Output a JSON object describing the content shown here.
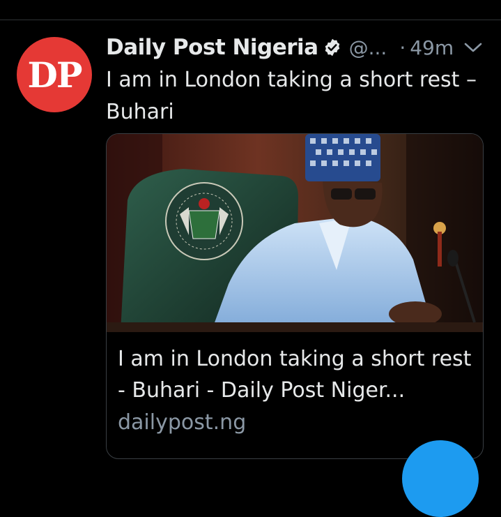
{
  "tweet": {
    "author_name": "Daily Post Nigeria",
    "handle": "@...",
    "separator": "·",
    "time": "49m",
    "avatar_text": "DP",
    "text": "I am in London taking a short rest – Buhari",
    "icons": {
      "verified": "verified-badge-icon",
      "more": "chevron-down-icon"
    }
  },
  "card": {
    "title": "I am in London taking a short rest - Buhari - Daily Post Niger...",
    "domain": "dailypost.ng"
  },
  "colors": {
    "accent": "#1d9bf0",
    "avatar_bg": "#e53935",
    "background": "#000000"
  }
}
